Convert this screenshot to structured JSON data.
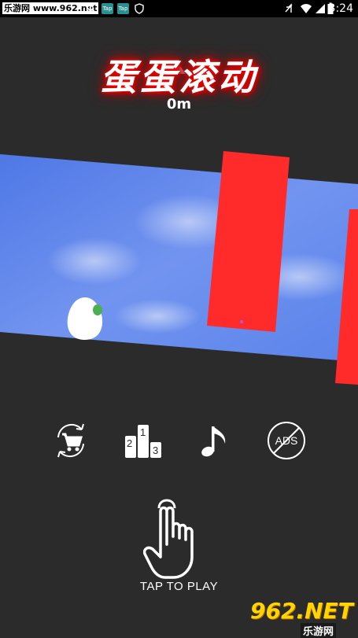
{
  "status_bar": {
    "site_label": "乐游网 www.962.net",
    "tap_badge_1": "Tap",
    "tap_badge_2": "Tap",
    "time": "3:24",
    "icons": [
      "download-icon",
      "vpn-icon",
      "tap-app-icon",
      "tap-app-icon",
      "shield-icon",
      "mute-icon",
      "wifi-icon",
      "signal-icon",
      "battery-icon"
    ]
  },
  "game": {
    "title": "蛋蛋滚动",
    "distance": "0m",
    "menu_icons": [
      "shop-icon",
      "leaderboard-icon",
      "music-icon",
      "no-ads-icon"
    ],
    "leaderboard_ranks": [
      "2",
      "1",
      "3"
    ],
    "no_ads_label": "ADS",
    "tap_to_play": "TAP TO PLAY",
    "colors": {
      "background": "#2b2b2b",
      "track": "#5b83ea",
      "obstacle": "#ff2b2b",
      "egg": "#ffffff",
      "egg_spot": "#4caf50",
      "title_glow": "#e00000"
    }
  },
  "watermark": {
    "logo": "962.NET",
    "sub": "乐游网"
  }
}
